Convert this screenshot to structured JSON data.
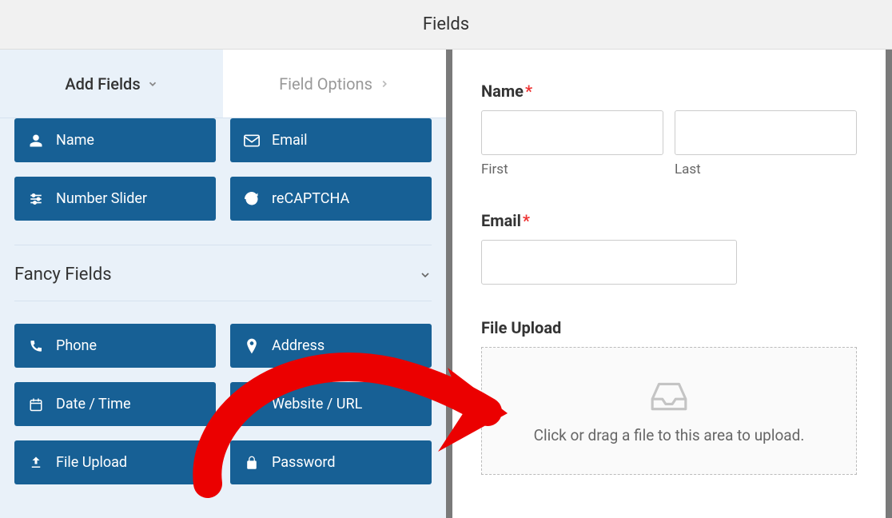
{
  "header": {
    "title": "Fields"
  },
  "tabs": {
    "add_fields": "Add Fields",
    "field_options": "Field Options"
  },
  "standard_fields": [
    {
      "icon": "user",
      "label": "Name"
    },
    {
      "icon": "envelope",
      "label": "Email"
    },
    {
      "icon": "sliders",
      "label": "Number Slider"
    },
    {
      "icon": "recaptcha",
      "label": "reCAPTCHA"
    }
  ],
  "fancy_section_label": "Fancy Fields",
  "fancy_fields": [
    {
      "icon": "phone",
      "label": "Phone"
    },
    {
      "icon": "map-pin",
      "label": "Address"
    },
    {
      "icon": "calendar",
      "label": "Date / Time"
    },
    {
      "icon": "link",
      "label": "Website / URL"
    },
    {
      "icon": "upload",
      "label": "File Upload"
    },
    {
      "icon": "lock",
      "label": "Password"
    }
  ],
  "preview": {
    "name_label": "Name",
    "first_label": "First",
    "last_label": "Last",
    "email_label": "Email",
    "file_upload_label": "File Upload",
    "upload_instruction": "Click or drag a file to this area to upload."
  }
}
